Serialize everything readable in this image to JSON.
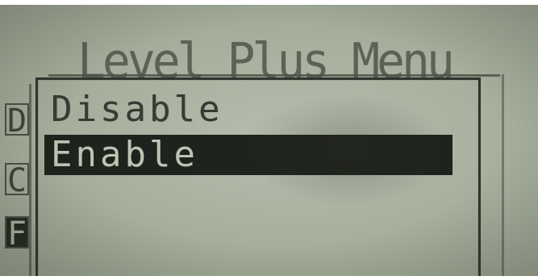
{
  "device_screen": {
    "background_menu": {
      "title": "Level Plus Menu",
      "left_letters": [
        "D",
        "C",
        "F"
      ]
    },
    "popup": {
      "options": [
        {
          "label": "Disable",
          "selected": false
        },
        {
          "label": "Enable",
          "selected": true
        }
      ]
    }
  },
  "colors": {
    "lcd_background": "#a9b19f",
    "lcd_text": "#363b33",
    "selection_background": "#1f231d",
    "selection_text": "#bcc4b3"
  }
}
